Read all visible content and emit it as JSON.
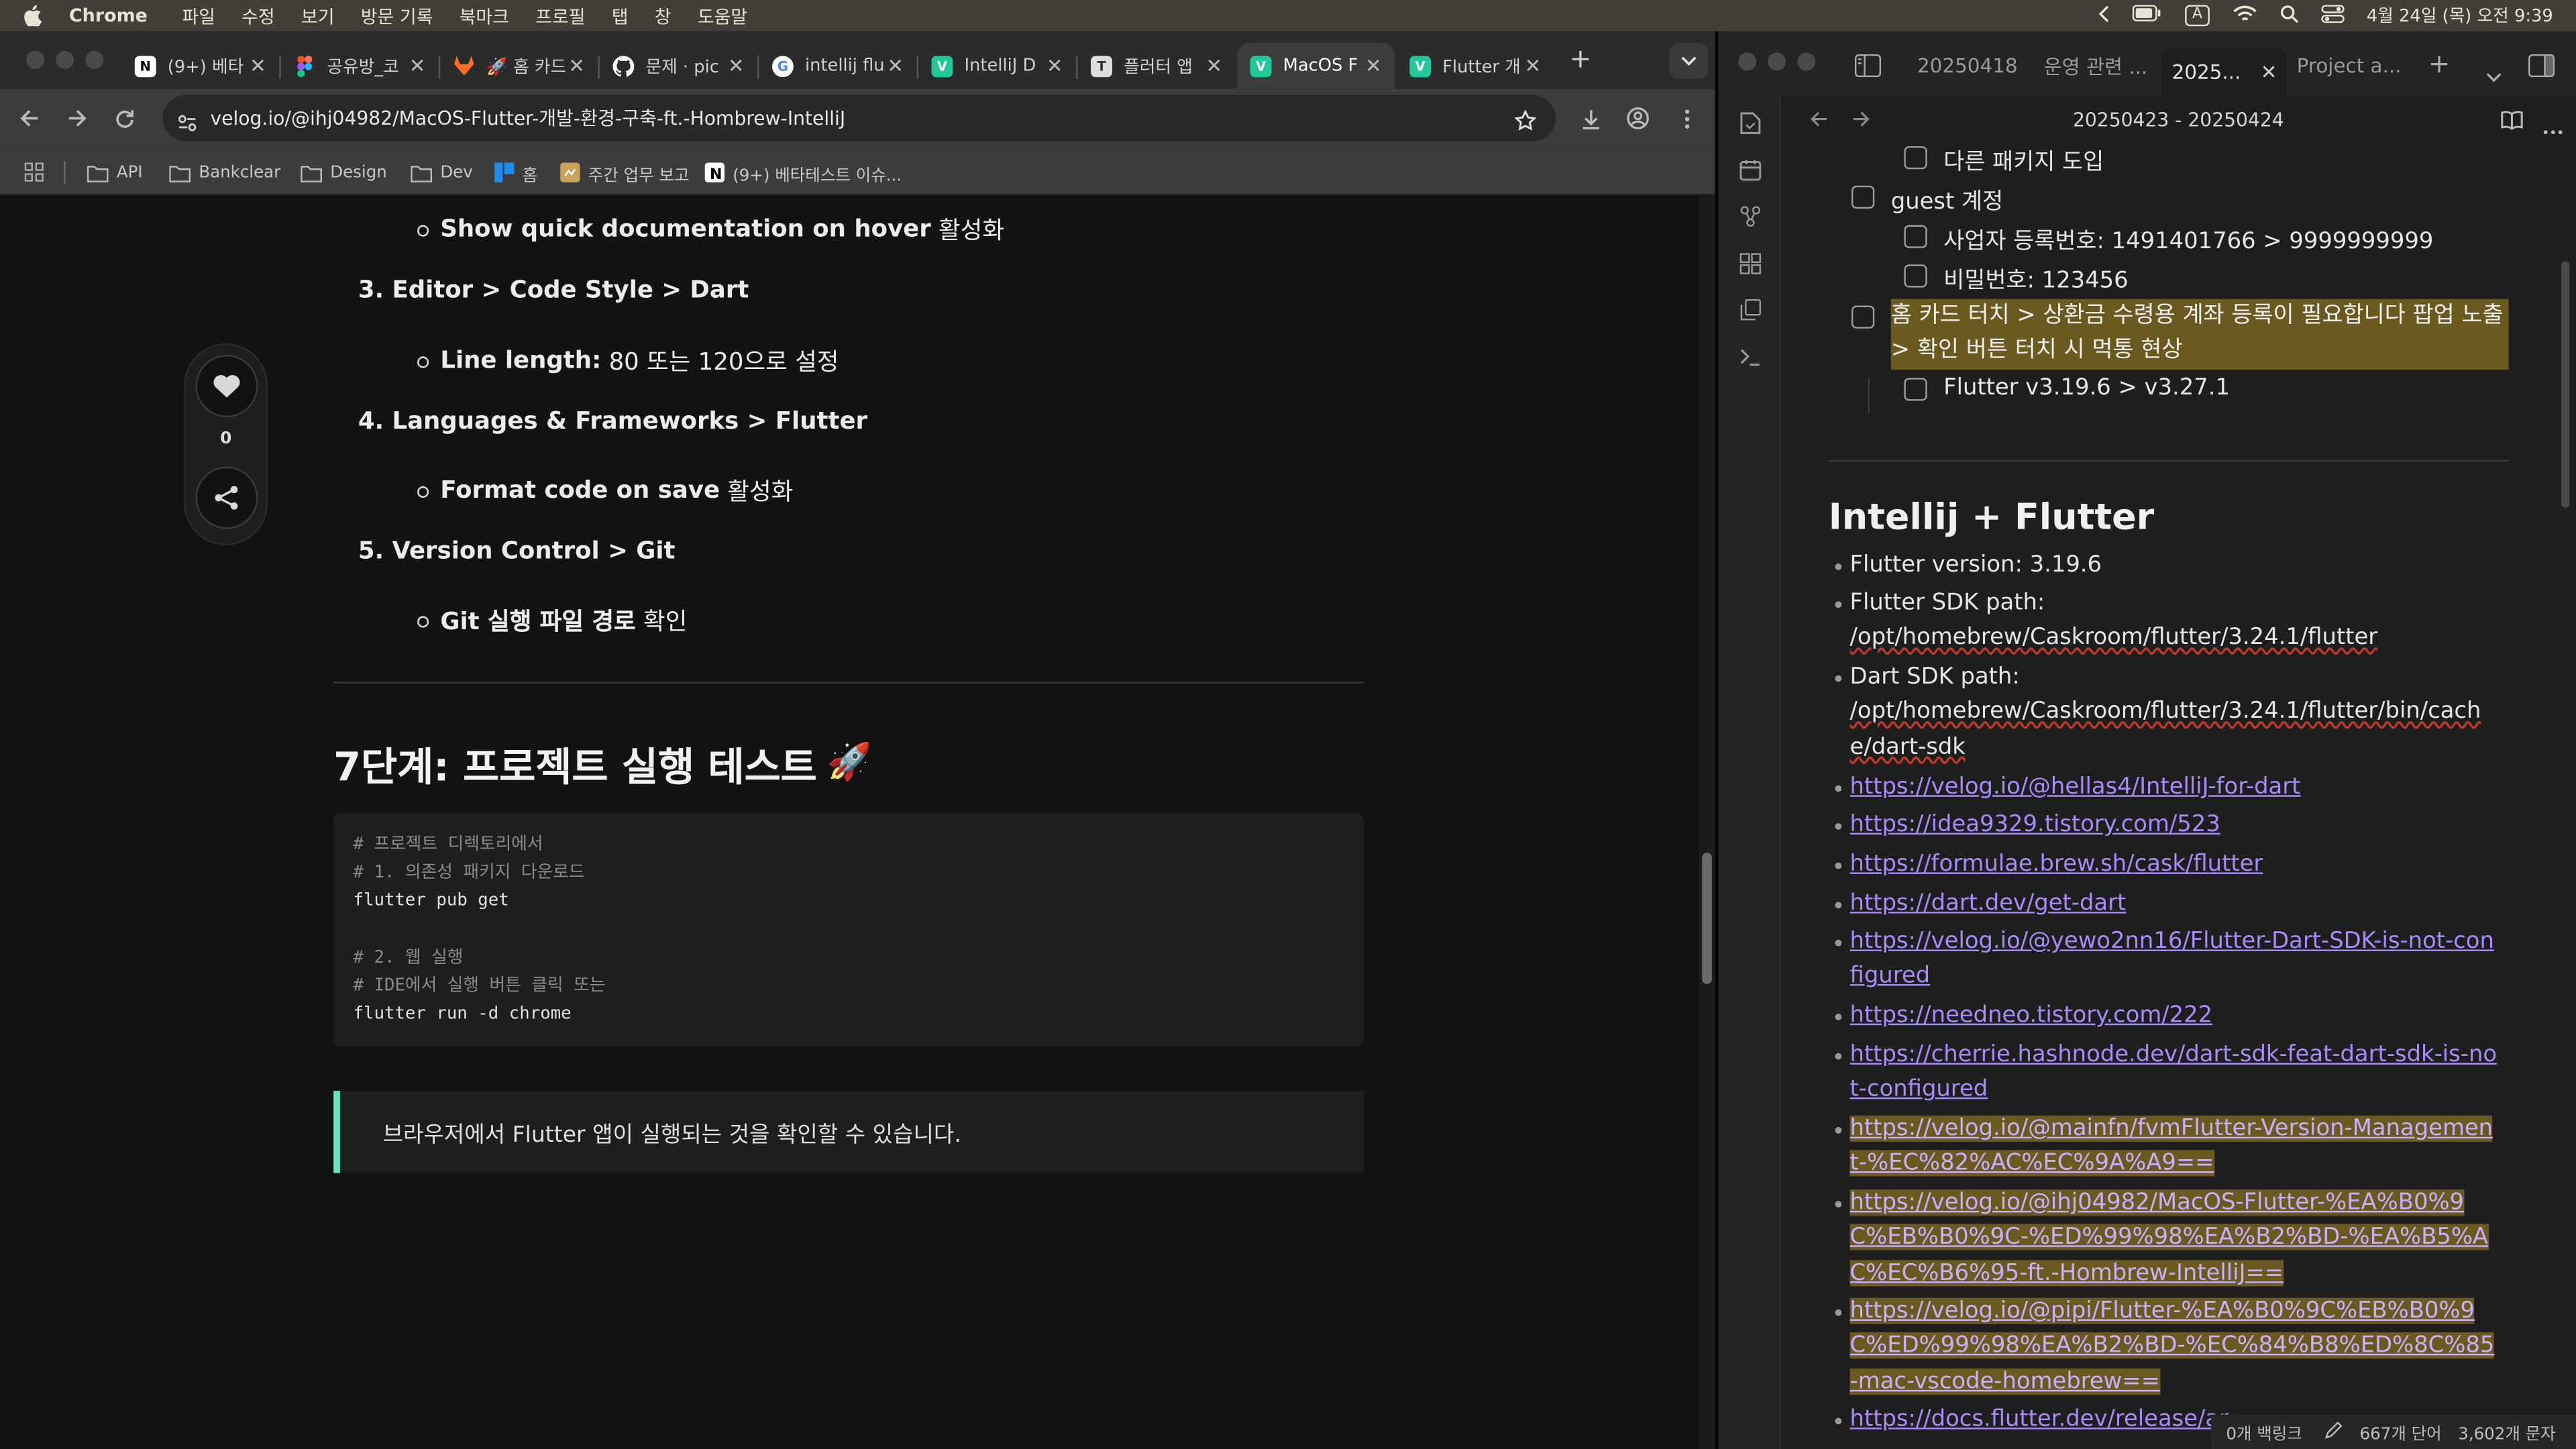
{
  "menubar": {
    "app_name": "Chrome",
    "items": [
      "파일",
      "수정",
      "보기",
      "방문 기록",
      "북마크",
      "프로필",
      "탭",
      "창",
      "도움말"
    ],
    "clock": "4월 24일 (목) 오전 9:39",
    "input_label": "A"
  },
  "chrome": {
    "tabs": [
      {
        "title": "(9+) 베타",
        "favicon": "notion-icon"
      },
      {
        "title": "공유방_코",
        "favicon": "figma-icon"
      },
      {
        "title": "🚀 홈 카드",
        "favicon": "gitlab-icon"
      },
      {
        "title": "문제 · pic",
        "favicon": "github-icon"
      },
      {
        "title": "intellij flu",
        "favicon": "google-icon"
      },
      {
        "title": "IntelliJ D",
        "favicon": "velog-icon"
      },
      {
        "title": "플러터 앱",
        "favicon": "tistory-icon"
      },
      {
        "title": "MacOS F",
        "favicon": "velog-icon",
        "active": true
      },
      {
        "title": "Flutter 개",
        "favicon": "velog-icon"
      }
    ],
    "url": "velog.io/@ihj04982/MacOS-Flutter-개발-환경-구축-ft.-Hombrew-IntelliJ",
    "bookmarks": [
      "API",
      "Bankclear",
      "Design",
      "Dev",
      "홈",
      "주간 업무 보고",
      "(9+) 베타테스트 이슈..."
    ]
  },
  "article": {
    "items": [
      {
        "type": "bullet",
        "bold": "Show quick documentation on hover",
        "rest": " 활성화"
      },
      {
        "type": "ol",
        "text": "3. Editor > Code Style > Dart"
      },
      {
        "type": "bullet",
        "bold": "Line length:",
        "rest": " 80 또는 120으로 설정"
      },
      {
        "type": "ol",
        "text": "4. Languages & Frameworks > Flutter"
      },
      {
        "type": "bullet",
        "bold": "Format code on save",
        "rest": " 활성화"
      },
      {
        "type": "ol",
        "text": "5. Version Control > Git"
      },
      {
        "type": "bullet",
        "bold": "Git 실행 파일 경로",
        "rest": " 확인"
      }
    ],
    "step7_heading": "7단계: 프로젝트 실행 테스트",
    "step7_emoji": "🚀",
    "code_lines": [
      {
        "kind": "comment",
        "text": "# 프로젝트 디렉토리에서"
      },
      {
        "kind": "comment",
        "text": "# 1. 의존성 패키지 다운로드"
      },
      {
        "kind": "code",
        "text": "flutter pub get"
      },
      {
        "kind": "code",
        "text": ""
      },
      {
        "kind": "comment",
        "text": "# 2. 웹 실행"
      },
      {
        "kind": "comment",
        "text": "# IDE에서 실행 버튼 클릭 또는"
      },
      {
        "kind": "code",
        "text": "flutter run -d chrome"
      }
    ],
    "quote": "브라우저에서 Flutter 앱이 실행되는 것을 확인할 수 있습니다.",
    "like_count": "0"
  },
  "obsidian": {
    "tabs": [
      "20250418",
      "운영 관련 ...",
      "2025...",
      "Project a..."
    ],
    "note_title": "20250423 - 20250424",
    "checklist": [
      {
        "indent": 1,
        "text": "다른 패키지 도입"
      },
      {
        "indent": 0,
        "text": "guest 계정"
      },
      {
        "indent": 1,
        "text": "사업자 등록번호: 1491401766 > 9999999999"
      },
      {
        "indent": 1,
        "text": "비밀번호: 123456"
      },
      {
        "indent": 0,
        "text": "홈 카드 터치 > 상환금 수령용 계좌 등록이 필요합니다 팝업 노출 > 확인 버튼 터치 시 먹통 현상",
        "highlight": true
      },
      {
        "indent": 1,
        "text": "Flutter v3.19.6 > v3.27.1"
      }
    ],
    "heading": "Intellij + Flutter",
    "list": [
      {
        "text": "Flutter version: 3.19.6"
      },
      {
        "label": "Flutter SDK path:",
        "path": "/opt/homebrew/Caskroom/flutter/3.24.1/flutter"
      },
      {
        "label": "Dart SDK path:",
        "path": "/opt/homebrew/Caskroom/flutter/3.24.1/flutter/bin/cache/dart-sdk"
      },
      {
        "link": "https://velog.io/@hellas4/IntelliJ-for-dart"
      },
      {
        "link": "https://idea9329.tistory.com/523"
      },
      {
        "link": "https://formulae.brew.sh/cask/flutter"
      },
      {
        "link": "https://dart.dev/get-dart"
      },
      {
        "link": "https://velog.io/@yewo2nn16/Flutter-Dart-SDK-is-not-configured"
      },
      {
        "link": "https://needneo.tistory.com/222"
      },
      {
        "link": "https://cherrie.hashnode.dev/dart-sdk-feat-dart-sdk-is-not-configured"
      },
      {
        "link": "https://velog.io/@mainfn/fvmFlutter-Version-Management-%EC%82%AC%EC%9A%A9==",
        "highlight": true
      },
      {
        "link": "https://velog.io/@ihj04982/MacOS-Flutter-%EA%B0%9C%EB%B0%9C-%ED%99%98%EA%B2%BD-%EA%B5%AC%EC%B6%95-ft.-Hombrew-IntelliJ==",
        "highlight": true
      },
      {
        "link": "https://velog.io/@pipi/Flutter-%EA%B0%9C%EB%B0%9C%ED%99%98%EA%B2%BD-%EC%84%B8%ED%8C%85-mac-vscode-homebrew==",
        "highlight": true
      },
      {
        "link": "https://docs.flutter.dev/release/ar"
      }
    ],
    "status": {
      "backlinks": "0개 백링크",
      "words": "667개 단어",
      "chars": "3,602개 문자"
    }
  },
  "colors": {
    "accent_link": "#a88bfa",
    "highlight": "#6b5a20",
    "quote_border": "#63e6be"
  }
}
